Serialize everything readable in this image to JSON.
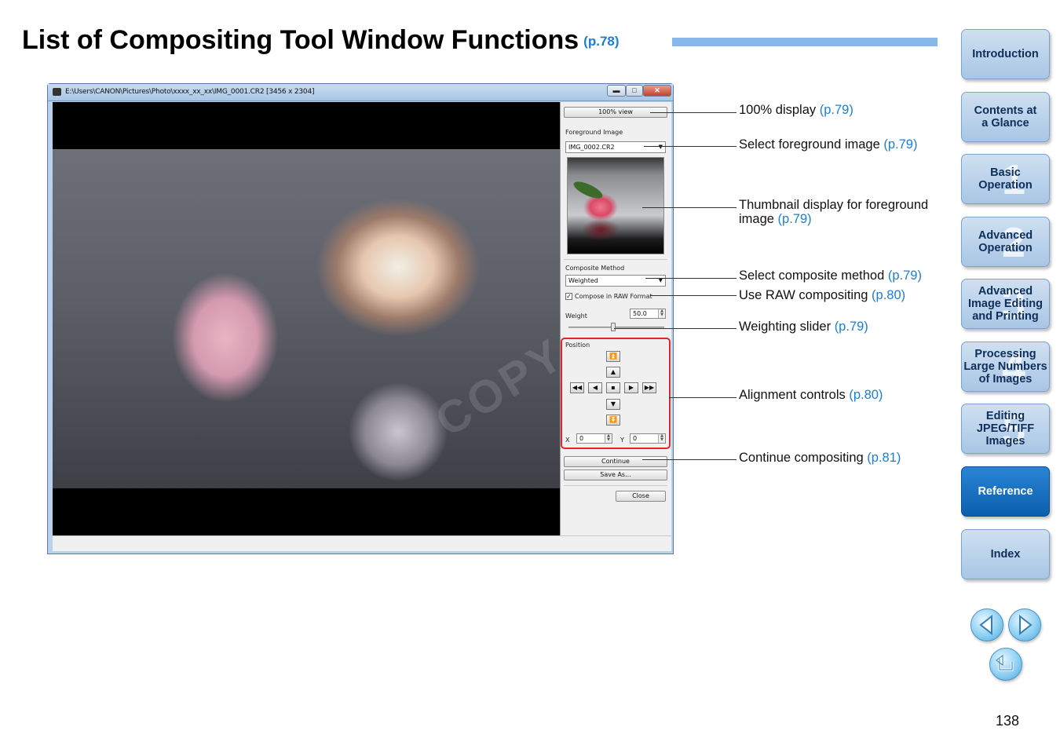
{
  "page": {
    "title": "List of Compositing Tool Window Functions",
    "title_ref": "(p.78)",
    "page_number": "138"
  },
  "window": {
    "title": "E:\\Users\\CANON\\Pictures\\Photo\\xxxx_xx_xx\\IMG_0001.CR2 [3456 x 2304]",
    "min_glyph": "▬",
    "max_glyph": "□",
    "close_glyph": "✕",
    "watermark": "COPY",
    "panel": {
      "view_button": "100% view",
      "foreground_label": "Foreground Image",
      "foreground_value": "IMG_0002.CR2",
      "composite_label": "Composite Method",
      "composite_value": "Weighted",
      "raw_checked": "✓",
      "raw_label": "Compose in RAW Format",
      "weight_label": "Weight",
      "weight_value": "50.0",
      "position_label": "Position",
      "x_label": "X",
      "x_value": "0",
      "y_label": "Y",
      "y_value": "0",
      "continue_button": "Continue",
      "save_button": "Save As...",
      "close_button": "Close"
    }
  },
  "callouts": [
    {
      "text": "100% display",
      "ref": "(p.79)"
    },
    {
      "text": "Select foreground image",
      "ref": "(p.79)"
    },
    {
      "text": "Thumbnail display for foreground",
      "text2": "image",
      "ref": "(p.79)"
    },
    {
      "text": "Select composite method",
      "ref": "(p.79)"
    },
    {
      "text": "Use RAW compositing",
      "ref": "(p.80)"
    },
    {
      "text": "Weighting slider",
      "ref": "(p.79)"
    },
    {
      "text": "Alignment controls",
      "ref": "(p.80)"
    },
    {
      "text": "Continue compositing",
      "ref": "(p.81)"
    }
  ],
  "nav": [
    {
      "line1": "Introduction",
      "line2": "",
      "line3": "",
      "num": ""
    },
    {
      "line1": "Contents at",
      "line2": "a Glance",
      "line3": "",
      "num": ""
    },
    {
      "line1": "Basic",
      "line2": "Operation",
      "line3": "",
      "num": "1"
    },
    {
      "line1": "Advanced",
      "line2": "Operation",
      "line3": "",
      "num": "2"
    },
    {
      "line1": "Advanced",
      "line2": "Image Editing",
      "line3": "and Printing",
      "num": "3"
    },
    {
      "line1": "Processing",
      "line2": "Large Numbers",
      "line3": "of Images",
      "num": "4"
    },
    {
      "line1": "Editing",
      "line2": "JPEG/TIFF",
      "line3": "Images",
      "num": "5"
    },
    {
      "line1": "Reference",
      "line2": "",
      "line3": "",
      "num": ""
    },
    {
      "line1": "Index",
      "line2": "",
      "line3": "",
      "num": ""
    }
  ],
  "colors": {
    "link": "#1a7fd4",
    "nav_bg": "#a9c6e5",
    "nav_active": "#0b5fae",
    "highlight_box": "#e0262b"
  },
  "icons": {
    "prev": "previous-page-icon",
    "next": "next-page-icon",
    "back": "return-icon"
  }
}
